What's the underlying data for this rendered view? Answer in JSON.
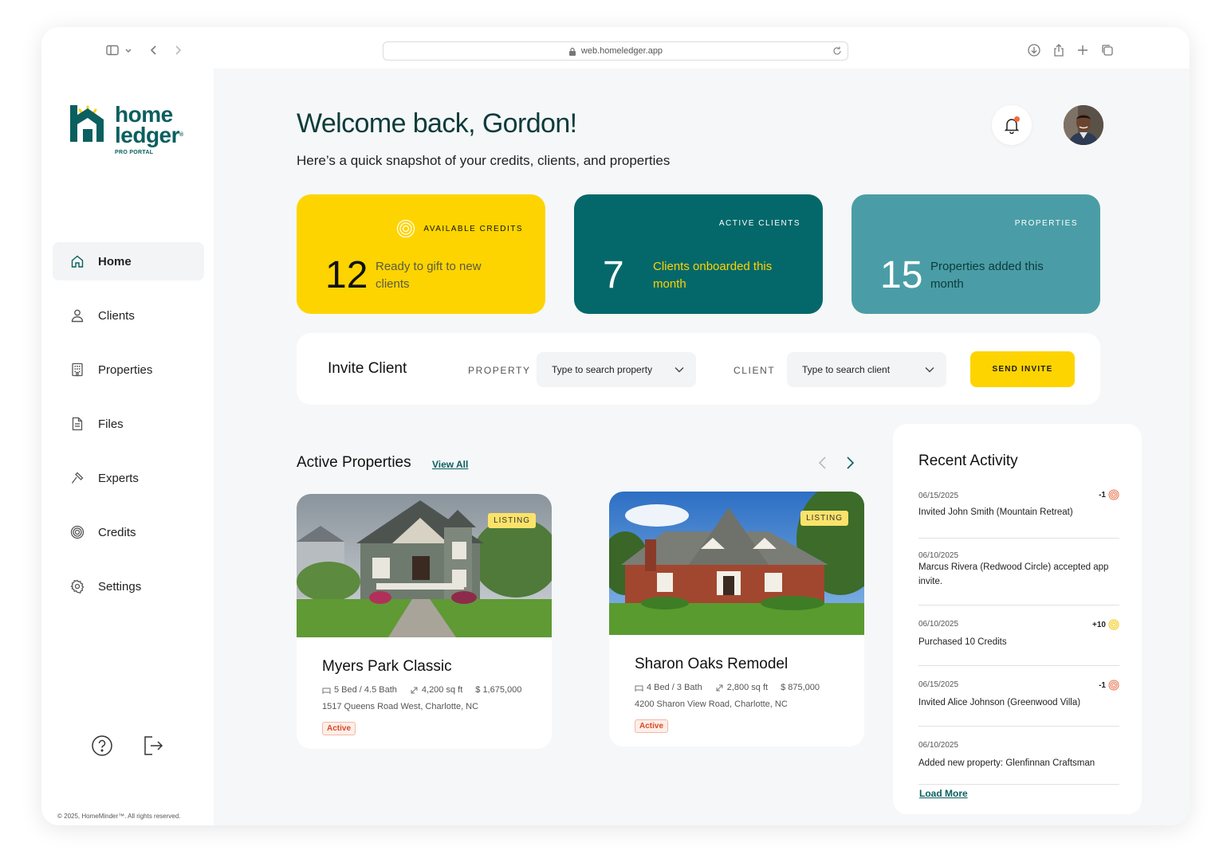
{
  "browser": {
    "url": "web.homeledger.app"
  },
  "brand": {
    "line1": "home",
    "line2": "ledger",
    "registered": "®",
    "tagline": "PRO PORTAL",
    "colors": {
      "teal": "#0b5f5f",
      "yellow": "#fdd400",
      "teal_dark": "#04686a",
      "teal_light": "#4a9da6"
    }
  },
  "sidebar": {
    "items": [
      {
        "label": "Home",
        "icon": "home-icon",
        "active": true
      },
      {
        "label": "Clients",
        "icon": "user-icon"
      },
      {
        "label": "Properties",
        "icon": "building-icon"
      },
      {
        "label": "Files",
        "icon": "file-icon"
      },
      {
        "label": "Experts",
        "icon": "tool-icon"
      },
      {
        "label": "Credits",
        "icon": "coin-icon"
      },
      {
        "label": "Settings",
        "icon": "gear-icon"
      }
    ],
    "copyright": "© 2025, HomeMinder™. All rights reserved."
  },
  "header": {
    "title": "Welcome back, Gordon!",
    "subtitle": "Here’s a quick snapshot of your credits, clients, and properties"
  },
  "stats": [
    {
      "label": "AVAILABLE CREDITS",
      "value": "12",
      "desc": "Ready to gift to new clients"
    },
    {
      "label": "ACTIVE CLIENTS",
      "value": "7",
      "desc": "Clients onboarded this month"
    },
    {
      "label": "PROPERTIES",
      "value": "15",
      "desc": "Properties added this month"
    }
  ],
  "invite": {
    "title": "Invite Client",
    "property_label": "PROPERTY",
    "property_placeholder": "Type to search property",
    "client_label": "CLIENT",
    "client_placeholder": "Type to search client",
    "send_label": "SEND INVITE"
  },
  "active_properties": {
    "title": "Active Properties",
    "view_all": "View All",
    "cards": [
      {
        "tag": "LISTING",
        "name": "Myers Park Classic",
        "beds": "5 Bed / 4.5 Bath",
        "area": "4,200 sq ft",
        "price": "$ 1,675,000",
        "address": "1517 Queens Road West, Charlotte, NC",
        "status": "Active"
      },
      {
        "tag": "LISTING",
        "name": "Sharon Oaks Remodel",
        "beds": "4 Bed / 3 Bath",
        "area": "2,800 sq ft",
        "price": "$ 875,000",
        "address": "4200 Sharon View Road, Charlotte, NC",
        "status": "Active"
      }
    ]
  },
  "activity": {
    "title": "Recent Activity",
    "items": [
      {
        "date": "06/15/2025",
        "text": "Invited John Smith (Mountain Retreat)",
        "amount": "-1",
        "coin": "red"
      },
      {
        "date": "06/10/2025",
        "text": "Marcus Rivera (Redwood Circle) accepted app invite.",
        "amount": "",
        "coin": ""
      },
      {
        "date": "06/10/2025",
        "text": "Purchased 10 Credits",
        "amount": "+10",
        "coin": "yellow"
      },
      {
        "date": "06/15/2025",
        "text": "Invited Alice Johnson (Greenwood Villa)",
        "amount": "-1",
        "coin": "red"
      },
      {
        "date": "06/10/2025",
        "text": "Added new property: Glenfinnan Craftsman",
        "amount": "",
        "coin": ""
      }
    ],
    "load_more": "Load More"
  }
}
